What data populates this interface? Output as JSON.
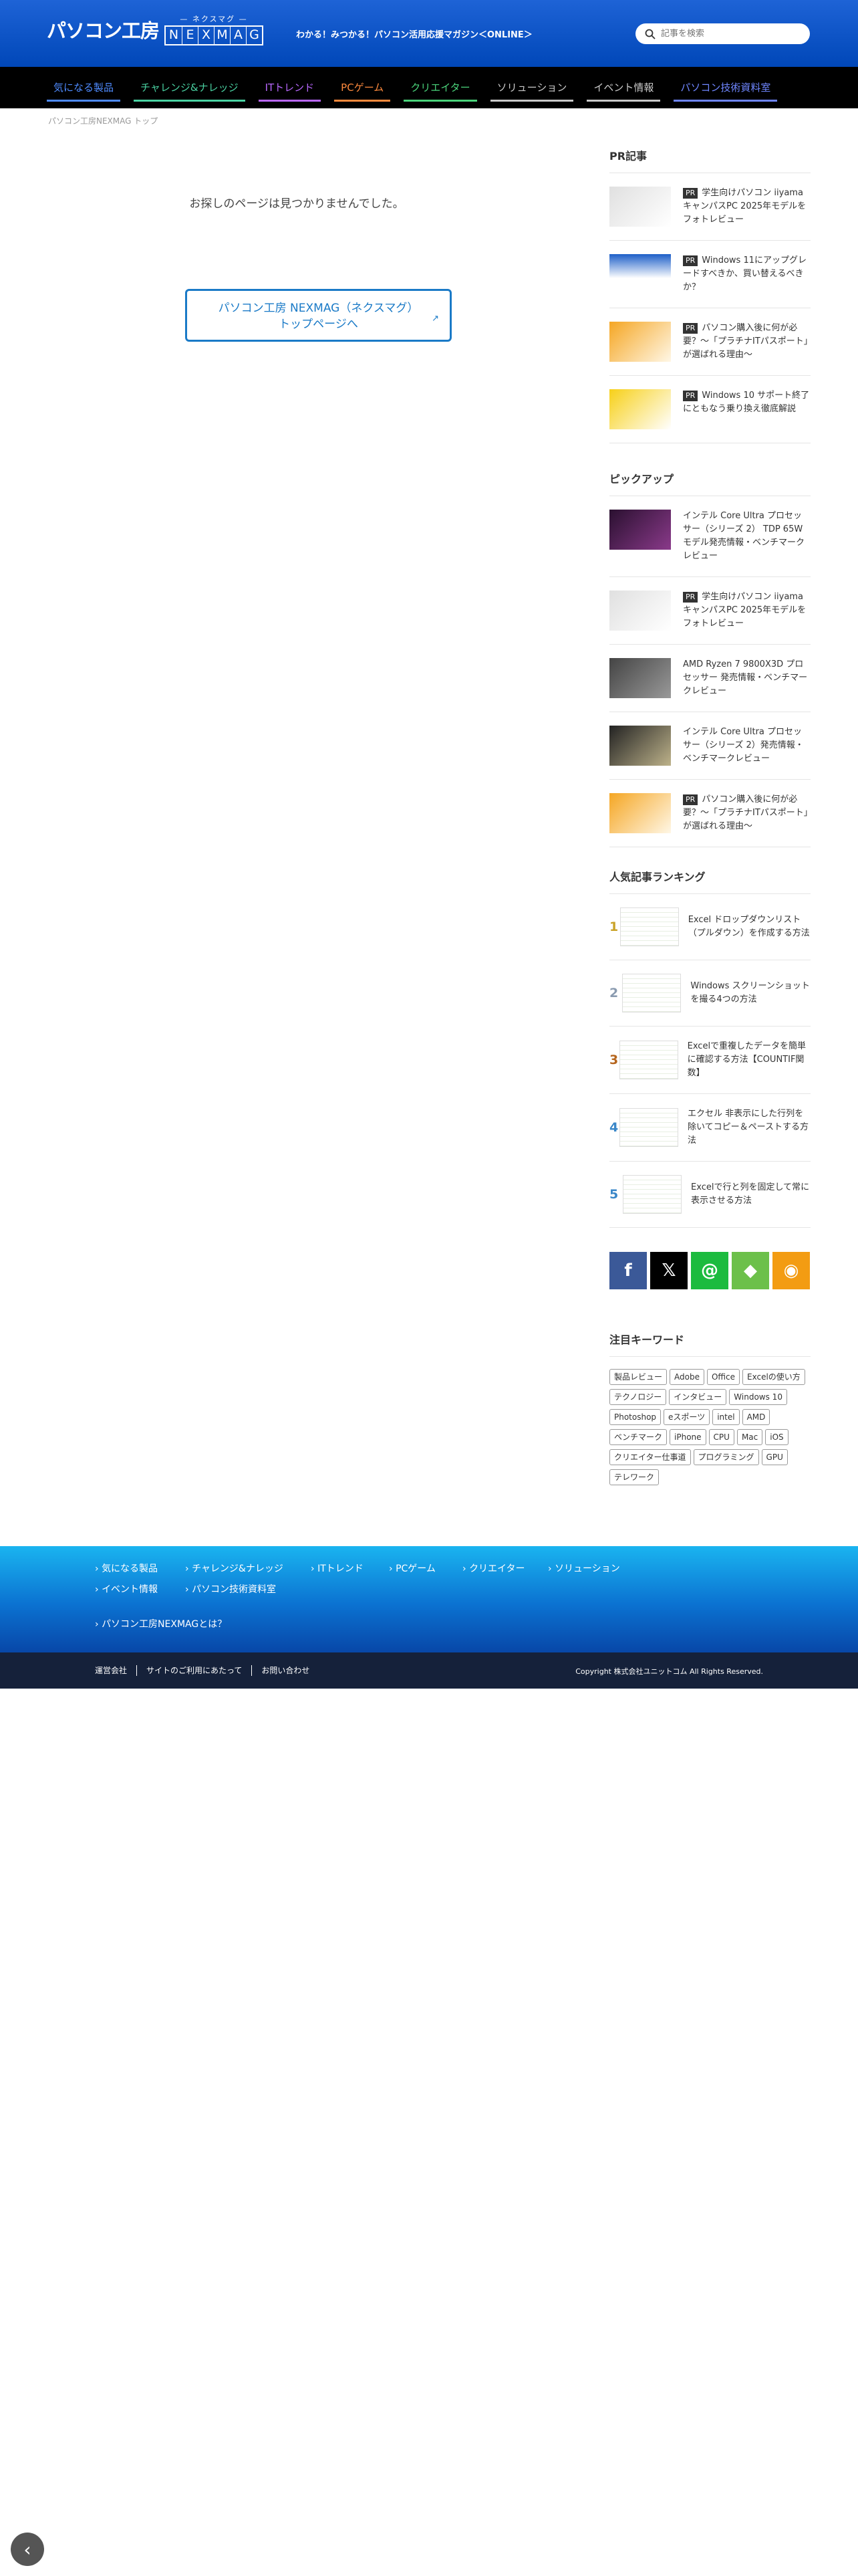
{
  "header": {
    "logo_jp": "パソコン工房",
    "logo_kana": "— ネクスマグ —",
    "logo_letters": [
      "N",
      "E",
      "X",
      "M",
      "A",
      "G"
    ],
    "tagline": "わかる！みつかる！パソコン活用応援マガジン＜ONLINE＞",
    "search_placeholder": "記事を検索"
  },
  "nav": [
    {
      "label": "気になる製品",
      "color": "#4f8bff"
    },
    {
      "label": "チャレンジ&ナレッジ",
      "color": "#4ad2a2"
    },
    {
      "label": "ITトレンド",
      "color": "#b968ff"
    },
    {
      "label": "PCゲーム",
      "color": "#ff8a3d"
    },
    {
      "label": "クリエイター",
      "color": "#4ad27a"
    },
    {
      "label": "ソリューション",
      "color": "#c9c9c9"
    },
    {
      "label": "イベント情報",
      "color": "#c9c9c9"
    },
    {
      "label": "パソコン技術資料室",
      "color": "#6f86ff"
    }
  ],
  "breadcrumb": "パソコン工房NEXMAG トップ",
  "main": {
    "message": "お探しのページは見つかりませんでした。",
    "button_line1": "パソコン工房 NEXMAG（ネクスマグ）",
    "button_line2": "トップページへ"
  },
  "pr": {
    "heading": "PR記事",
    "items": [
      {
        "badge": "PR",
        "text": "学生向けパソコン iiyama キャンパスPC 2025年モデルをフォトレビュー"
      },
      {
        "badge": "PR",
        "text": "Windows 11にアップグレードすべきか、買い替えるべきか？"
      },
      {
        "badge": "PR",
        "text": "パソコン購入後に何が必要？〜「プラチナITパスポート」が選ばれる理由〜"
      },
      {
        "badge": "PR",
        "text": "Windows 10 サポート終了にともなう乗り換え徹底解説"
      }
    ]
  },
  "pickup": {
    "heading": "ピックアップ",
    "items": [
      {
        "badge": "",
        "text": "インテル Core Ultra プロセッサー（シリーズ 2） TDP 65Wモデル発売情報・ベンチマークレビュー"
      },
      {
        "badge": "PR",
        "text": "学生向けパソコン iiyama キャンパスPC 2025年モデルをフォトレビュー"
      },
      {
        "badge": "",
        "text": "AMD Ryzen 7 9800X3D プロセッサー 発売情報・ベンチマークレビュー"
      },
      {
        "badge": "",
        "text": "インテル Core Ultra プロセッサー（シリーズ 2）発売情報・ベンチマークレビュー"
      },
      {
        "badge": "PR",
        "text": "パソコン購入後に何が必要？〜「プラチナITパスポート」が選ばれる理由〜"
      }
    ]
  },
  "ranking": {
    "heading": "人気記事ランキング",
    "items": [
      {
        "num": "1",
        "text": "Excel ドロップダウンリスト（プルダウン）を作成する方法",
        "color": "#c9a227"
      },
      {
        "num": "2",
        "text": "Windows スクリーンショットを撮る4つの方法",
        "color": "#8a9bb0"
      },
      {
        "num": "3",
        "text": "Excelで重複したデータを簡単に確認する方法【COUNTIF関数】",
        "color": "#b5651d"
      },
      {
        "num": "4",
        "text": "エクセル 非表示にした行列を除いてコピー＆ペーストする方法",
        "color": "#3a87c8"
      },
      {
        "num": "5",
        "text": "Excelで行と列を固定して常に表示させる方法",
        "color": "#3a87c8"
      }
    ]
  },
  "social": [
    {
      "icon": "facebook-icon",
      "glyph": "f",
      "color": "#3b5998"
    },
    {
      "icon": "x-icon",
      "glyph": "𝕏",
      "color": "#000000"
    },
    {
      "icon": "mail-icon",
      "glyph": "@",
      "color": "#1cbb3f"
    },
    {
      "icon": "feedly-icon",
      "glyph": "◆",
      "color": "#6cc04a"
    },
    {
      "icon": "rss-icon",
      "glyph": "◉",
      "color": "#f39c12"
    }
  ],
  "keywords": {
    "heading": "注目キーワード",
    "tags": [
      "製品レビュー",
      "Adobe",
      "Office",
      "Excelの使い方",
      "テクノロジー",
      "インタビュー",
      "Windows 10",
      "Photoshop",
      "eスポーツ",
      "intel",
      "AMD",
      "ベンチマーク",
      "iPhone",
      "CPU",
      "Mac",
      "iOS",
      "クリエイター仕事道",
      "プログラミング",
      "GPU",
      "テレワーク"
    ]
  },
  "footer": {
    "links": [
      "気になる製品",
      "チャレンジ&ナレッジ",
      "ITトレンド",
      "PCゲーム",
      "クリエイター",
      "ソリューション",
      "イベント情報",
      "パソコン技術資料室",
      "パソコン工房NEXMAGとは？"
    ],
    "bottom_links": [
      "運営会社",
      "サイトのご利用にあたって",
      "お問い合わせ"
    ],
    "copyright": "Copyright 株式会社ユニットコム All Rights Reserved."
  }
}
